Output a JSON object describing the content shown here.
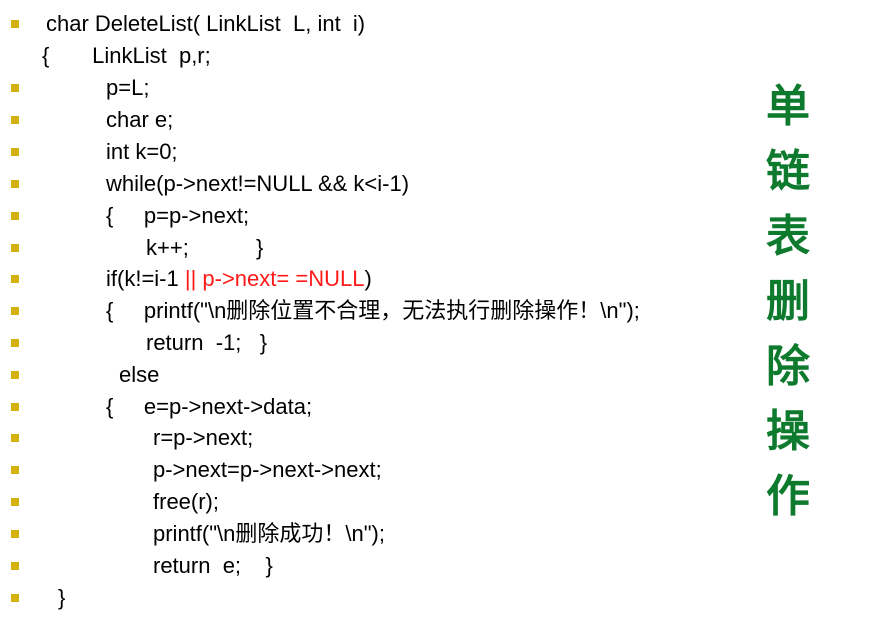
{
  "code_lines": [
    {
      "bullet": true,
      "text": "char DeleteList( LinkList  L, int  i)"
    },
    {
      "bullet": false,
      "text": "{       LinkList  p,r;"
    },
    {
      "bullet": true,
      "text": "p=L;"
    },
    {
      "bullet": true,
      "text": "char e;"
    },
    {
      "bullet": true,
      "text": "int k=0;"
    },
    {
      "bullet": true,
      "text": "while(p->next!=NULL && k<i-1)"
    },
    {
      "bullet": true,
      "text": "{     p=p->next;"
    },
    {
      "bullet": true,
      "text": "k++;           }"
    },
    {
      "bullet": true,
      "text": "if(k!=i-1 ",
      "highlight": "|| p->next= =NULL",
      "after": ")"
    },
    {
      "bullet": true,
      "text": "{     printf(\"\\n删除位置不合理，无法执行删除操作！\\n\");"
    },
    {
      "bullet": true,
      "text": "return  -1;   }"
    },
    {
      "bullet": true,
      "text": "else"
    },
    {
      "bullet": true,
      "text": "{     e=p->next->data;"
    },
    {
      "bullet": true,
      "text": "r=p->next;"
    },
    {
      "bullet": true,
      "text": "p->next=p->next->next;"
    },
    {
      "bullet": true,
      "text": "free(r);"
    },
    {
      "bullet": true,
      "text": "printf(\"\\n删除成功！\\n\");"
    },
    {
      "bullet": true,
      "text": "return  e;    }"
    },
    {
      "bullet": true,
      "text": "}"
    }
  ],
  "side_title": [
    "单",
    "链",
    "表",
    "删",
    "除",
    "操",
    "作"
  ],
  "colors": {
    "bullet": "#D4B20E",
    "code": "#000000",
    "highlight": "#FF1A1A",
    "title": "#0E7A2E"
  }
}
